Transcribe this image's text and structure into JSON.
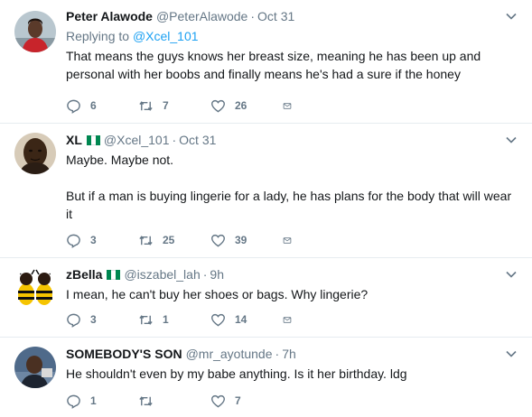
{
  "tweets": [
    {
      "fullname": "Peter Alawode",
      "username": "@PeterAlawode",
      "time": "Oct 31",
      "replying_prefix": "Replying to",
      "replying_to": "@Xcel_101",
      "text": "That means the guys knows her breast size, meaning he has been up and personal with her boobs and finally means he's had a sure if the honey",
      "replies": "6",
      "retweets": "7",
      "likes": "26"
    },
    {
      "fullname": "XL",
      "username": "@Xcel_101",
      "time": "Oct 31",
      "text": "Maybe. Maybe not.\n\nBut if a man is buying lingerie for a lady, he has plans for the body that will wear it",
      "replies": "3",
      "retweets": "25",
      "likes": "39"
    },
    {
      "fullname": "zBella",
      "username": "@iszabel_lah",
      "time": "9h",
      "text": "I mean, he can't buy her shoes or bags. Why lingerie?",
      "replies": "3",
      "retweets": "1",
      "likes": "14"
    },
    {
      "fullname": "SOMEBODY'S SON",
      "username": "@mr_ayotunde",
      "time": "7h",
      "text": "He shouldn't even by my babe anything. Is it her birthday. ldg",
      "replies": "1",
      "retweets": "",
      "likes": "7"
    }
  ],
  "separator": "·",
  "colors": {
    "accent": "#1da1f2",
    "secondary_text": "#657786",
    "divider": "#e6ecf0",
    "flag_green": "#008751"
  },
  "icons": [
    "reply-icon",
    "retweet-icon",
    "like-icon",
    "direct-message-icon",
    "chevron-down-icon"
  ]
}
